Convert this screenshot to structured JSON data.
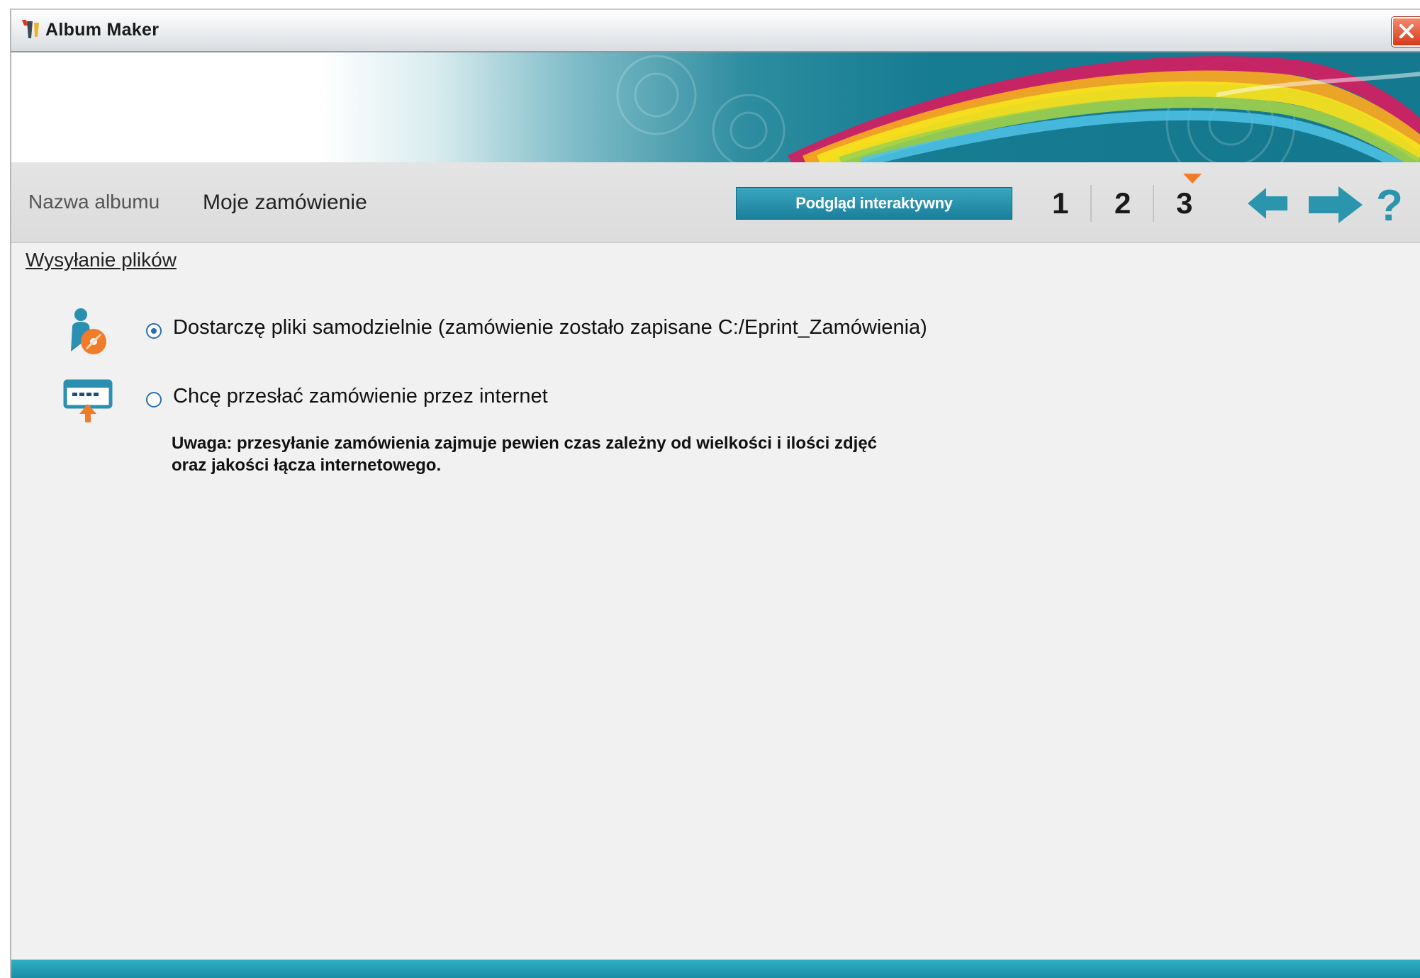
{
  "window": {
    "title": "Album Maker"
  },
  "toolbar": {
    "album_label": "Nazwa albumu",
    "album_name": "Moje zamówienie",
    "preview_button": "Podgląd interaktywny",
    "steps": [
      "1",
      "2",
      "3"
    ],
    "current_step": "3",
    "help_label": "?"
  },
  "content": {
    "section_title": "Wysyłanie plików",
    "options": [
      {
        "label": "Dostarczę pliki samodzielnie (zamówienie zostało zapisane C:/Eprint_Zamówienia)",
        "icon": "person-disc-icon",
        "selected": true
      },
      {
        "label": "Chcę przesłać zamówienie przez internet",
        "icon": "upload-computer-icon",
        "selected": false
      }
    ],
    "note_line1": "Uwaga: przesyłanie zamówienia zajmuje pewien czas zależny od wielkości i ilości zdjęć",
    "note_line2": "oraz jakości łącza internetowego."
  },
  "colors": {
    "accent": "#1a8da4",
    "button": "#2a95ad",
    "step_marker": "#f07c2a",
    "close": "#d6391b"
  }
}
